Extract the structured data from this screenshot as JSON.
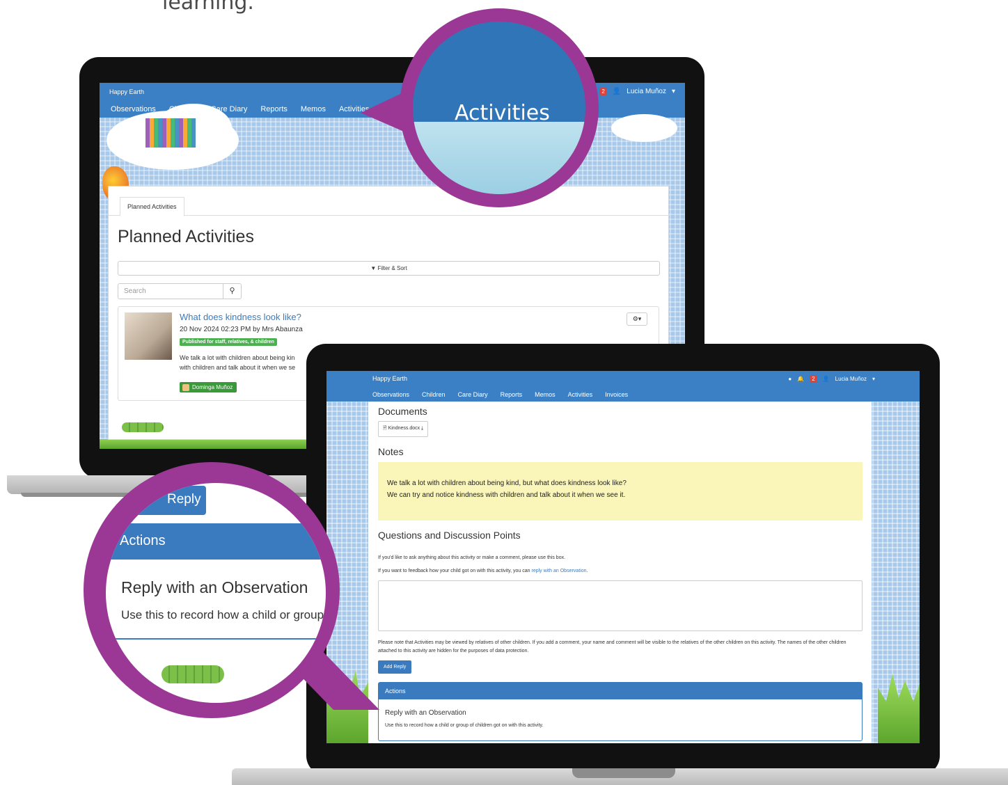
{
  "intro_text": "learning.",
  "laptop_back": {
    "brand": "Happy Earth",
    "menu": [
      "Observations",
      "Children",
      "Care Diary",
      "Reports",
      "Memos",
      "Activities"
    ],
    "notification_count": "2",
    "user_name": "Lucia Muñoz",
    "tab_label": "Planned Activities",
    "page_title": "Planned Activities",
    "filter_label": "Filter & Sort",
    "search_placeholder": "Search",
    "activity": {
      "title": "What does kindness look like?",
      "meta": "20 Nov 2024 02:23 PM by Mrs Abaunza",
      "visibility": "Published for staff, relatives, & children",
      "desc_line1": "We talk a lot with children about being kin",
      "desc_line2": "with children and talk about it when we se",
      "child_tag": "Dominga Muñoz"
    }
  },
  "laptop_front": {
    "brand": "Happy Earth",
    "menu": [
      "Observations",
      "Children",
      "Care Diary",
      "Reports",
      "Memos",
      "Activities",
      "Invoices"
    ],
    "notification_count": "2",
    "user_name": "Lucia Muñoz",
    "documents_heading": "Documents",
    "document_file": "Kindness.docx",
    "notes_heading": "Notes",
    "notes_line1": "We talk a lot with children about being kind, but what does kindness look like?",
    "notes_line2": "We can try and notice kindness with children and talk about it when we see it.",
    "questions_heading": "Questions and Discussion Points",
    "questions_line1": "If you'd like to ask anything about this activity or make a comment, please use this box.",
    "questions_line2_prefix": "If you want to feedback how your child got on with this activity, you can ",
    "questions_line2_link": "reply with an Observation",
    "privacy_note": "Please note that Activities may be viewed by relatives of other children. If you add a comment, your name and comment will be visible to the relatives of the other children on this activity. The names of the other children attached to this activity are hidden for the purposes of data protection.",
    "add_reply_label": "Add Reply",
    "actions_heading": "Actions",
    "reply_observation_title": "Reply with an Observation",
    "reply_observation_desc": "Use this to record how a child or group of children got on with this activity."
  },
  "magnifier_top": {
    "label": "Activities"
  },
  "magnifier_bottom": {
    "reply_label": "Reply",
    "actions_label": "Actions",
    "observation_title": "Reply with an Observation",
    "observation_desc": "Use this to record how a child or group"
  },
  "colors": {
    "brand_blue": "#3b7fc4",
    "accent_purple": "#9b3896",
    "published_green": "#4caf50",
    "notes_yellow": "#faf5b8",
    "badge_red": "#d9453d"
  }
}
